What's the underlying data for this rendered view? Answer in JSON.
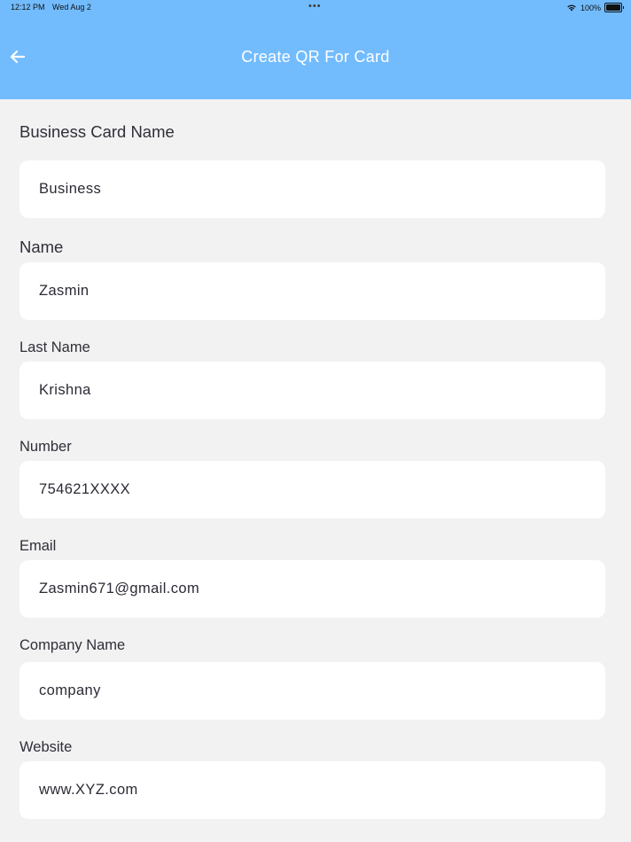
{
  "status_bar": {
    "time": "12:12 PM",
    "date": "Wed Aug 2",
    "dots": "•••",
    "battery_text": "100%",
    "battery_level": 1.0
  },
  "header": {
    "title": "Create QR For Card",
    "back_icon": "arrow-left-icon",
    "background_color": "#72bcfe"
  },
  "form": {
    "business_card_name": {
      "label": "Business Card Name",
      "value": "Business"
    },
    "name": {
      "label": "Name",
      "value": "Zasmin"
    },
    "last_name": {
      "label": "Last Name",
      "value": "Krishna"
    },
    "number": {
      "label": "Number",
      "value": "754621XXXX"
    },
    "email": {
      "label": "Email",
      "value": "Zasmin671@gmail.com"
    },
    "company_name": {
      "label": "Company Name",
      "value": "company"
    },
    "website": {
      "label": "Website",
      "value": "www.XYZ.com"
    }
  }
}
